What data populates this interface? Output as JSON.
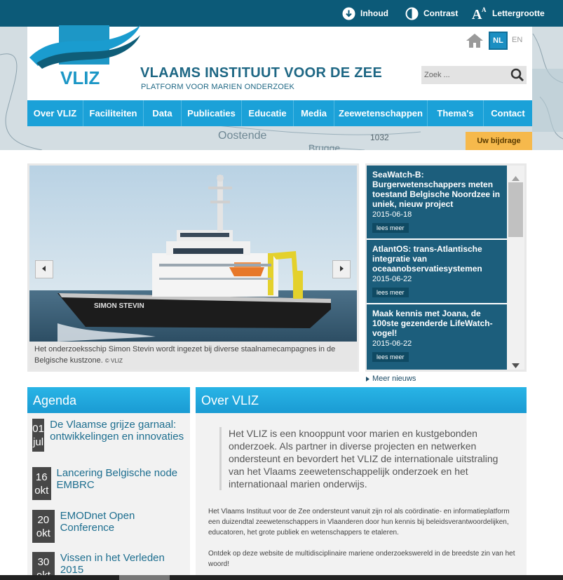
{
  "toolbar": {
    "content_label": "Inhoud",
    "contrast_label": "Contrast",
    "fontsize_label": "Lettergrootte"
  },
  "brand": {
    "logo_text": "VLIZ",
    "title": "VLAAMS INSTITUUT VOOR DE ZEE",
    "subtitle": "PLATFORM VOOR MARIEN ONDERZOEK"
  },
  "map_labels": {
    "city1": "Oostende",
    "city2": "Brugge",
    "depth": "1032"
  },
  "languages": {
    "active": "NL",
    "other": "EN"
  },
  "search": {
    "placeholder": "Zoek ..."
  },
  "nav": {
    "items": [
      {
        "label": "Over VLIZ"
      },
      {
        "label": "Faciliteiten"
      },
      {
        "label": "Data"
      },
      {
        "label": "Publicaties"
      },
      {
        "label": "Educatie"
      },
      {
        "label": "Media"
      },
      {
        "label": "Zeewetenschappen"
      },
      {
        "label": "Thema's"
      },
      {
        "label": "Contact"
      }
    ]
  },
  "contribute_label": "Uw bijdrage",
  "slide": {
    "ship_name": "SIMON STEVIN",
    "caption": "Het onderzoeksschip Simon Stevin wordt ingezet bij diverse staalnamecampagnes in de Belgische kustzone.",
    "credit": "© VLIZ"
  },
  "news": {
    "items": [
      {
        "title": "SeaWatch-B: Burgerwetenschappers meten toestand Belgische Noordzee in uniek, nieuw project",
        "date": "2015-06-18",
        "more": "lees meer"
      },
      {
        "title": "AtlantOS: trans-Atlantische integratie van oceaanobservatiesystemen",
        "date": "2015-06-22",
        "more": "lees meer"
      },
      {
        "title": "Maak kennis met Joana, de 100ste gezenderde LifeWatch-vogel!",
        "date": "2015-06-22",
        "more": "lees meer"
      }
    ],
    "more_news": "Meer nieuws"
  },
  "agenda": {
    "title": "Agenda",
    "items": [
      {
        "day": "01",
        "month": "jul",
        "title": "De Vlaamse grijze garnaal: ontwikkelingen en innovaties"
      },
      {
        "day": "16",
        "month": "okt",
        "title": "Lancering Belgische node EMBRC"
      },
      {
        "day": "20",
        "month": "okt",
        "title": "EMODnet Open Conference"
      },
      {
        "day": "30",
        "month": "okt",
        "title": "Vissen in het Verleden 2015"
      }
    ]
  },
  "about": {
    "title": "Over VLIZ",
    "quote": "Het VLIZ is een knooppunt voor marien en kustgebonden onderzoek. Als partner in diverse projecten en netwerken ondersteunt en bevordert het VLIZ de internationale uitstraling van het Vlaams zeewetenschappelijk onderzoek en het internationaal marien onderwijs.",
    "p1": "Het Vlaams Instituut voor de Zee ondersteunt vanuit zijn rol als coördinatie- en informatieplatform een duizendtal zeewetenschappers in Vlaanderen door hun kennis bij beleidsverantwoordelijken, educatoren, het grote publiek en wetenschappers te etaleren.",
    "p2": "Ontdek op deze website de multidisciplinaire mariene onderzoekswereld in de breedste zin van het woord!"
  }
}
